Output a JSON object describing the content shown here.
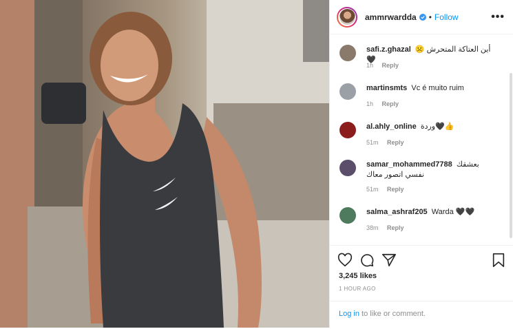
{
  "post": {
    "username": "ammrwardda",
    "dot": "•",
    "follow_label": "Follow",
    "more_label": "•••"
  },
  "comments": [
    {
      "user": "safi.z.ghazal",
      "text": "أين العتاكة المتحرش ☹️🖤",
      "time": "1h",
      "reply": "Reply",
      "avatar_color": "#8a7a6c"
    },
    {
      "user": "martinsmts",
      "text": "Vc é muito ruim",
      "time": "1h",
      "reply": "Reply",
      "avatar_color": "#9aa0a6"
    },
    {
      "user": "al.ahly_online",
      "text": "وردة🖤👍",
      "time": "51m",
      "reply": "Reply",
      "avatar_color": "#8b1d1d"
    },
    {
      "user": "samar_mohammed7788",
      "text": "بعشقك نفسي اتصور معاك",
      "time": "51m",
      "reply": "Reply",
      "avatar_color": "#5a4e6a"
    },
    {
      "user": "salma_ashraf205",
      "text": "Warda 🖤🖤",
      "time": "38m",
      "reply": "Reply",
      "avatar_color": "#4e7a5e"
    }
  ],
  "stats": {
    "likes": "3,245 likes",
    "time_ago": "1 HOUR AGO"
  },
  "login": {
    "link": "Log in",
    "rest": " to like or comment."
  },
  "icons": {
    "like": "heart-icon",
    "comment": "comment-icon",
    "share": "share-icon",
    "save": "bookmark-icon",
    "verified": "verified-badge-icon"
  },
  "colors": {
    "accent": "#0095f6",
    "muted": "#8e8e8e",
    "text": "#262626"
  }
}
